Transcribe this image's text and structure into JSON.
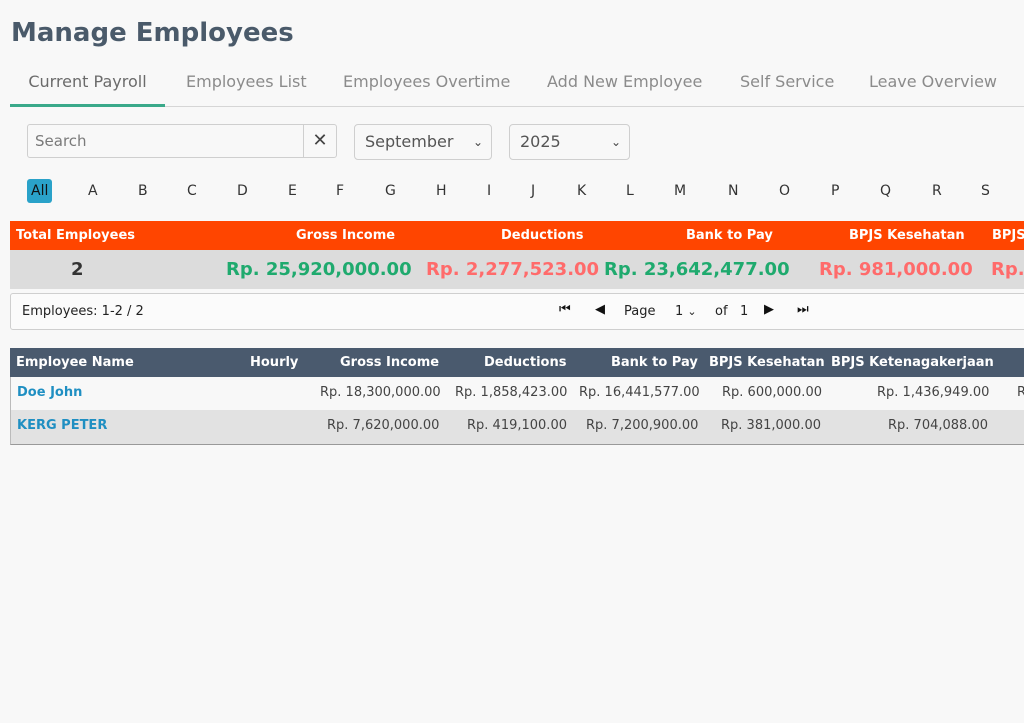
{
  "page": {
    "title": "Manage Employees"
  },
  "tabs": [
    {
      "label": "Current Payroll",
      "active": true
    },
    {
      "label": "Employees List"
    },
    {
      "label": "Employees Overtime"
    },
    {
      "label": "Add New Employee"
    },
    {
      "label": "Self Service"
    },
    {
      "label": "Leave Overview"
    }
  ],
  "filters": {
    "search_placeholder": "Search",
    "clear_icon": "✕",
    "month": "September",
    "year": "2025"
  },
  "alphabet": [
    "All",
    "A",
    "B",
    "C",
    "D",
    "E",
    "F",
    "G",
    "H",
    "I",
    "J",
    "K",
    "L",
    "M",
    "N",
    "O",
    "P",
    "Q",
    "R",
    "S"
  ],
  "summary": {
    "headers": {
      "total_employees": "Total Employees",
      "gross_income": "Gross Income",
      "deductions": "Deductions",
      "bank_to_pay": "Bank to Pay",
      "bpjs_kesehatan": "BPJS Kesehatan",
      "bpjs_next": "BPJS"
    },
    "values": {
      "total_employees": "2",
      "gross_income": "Rp. 25,920,000.00",
      "deductions": "Rp. 2,277,523.00",
      "bank_to_pay": "Rp. 23,642,477.00",
      "bpjs_kesehatan": "Rp. 981,000.00",
      "bpjs_next": "Rp."
    },
    "colors": {
      "header_bg": "#ff4500",
      "positive": "#1faa6e",
      "negative": "#ff6b6b"
    }
  },
  "pager": {
    "count_text": "Employees: 1-2 / 2",
    "page_label": "Page",
    "page_value": "1",
    "of_label": "of",
    "total_pages": "1"
  },
  "table": {
    "headers": {
      "name": "Employee Name",
      "hourly": "Hourly",
      "gross": "Gross Income",
      "deductions": "Deductions",
      "bank": "Bank to Pay",
      "bpjs_kes": "BPJS Kesehatan",
      "bpjs_ket": "BPJS Ketenagakerjaan"
    },
    "rows": [
      {
        "name": "Doe John",
        "hourly": "",
        "gross": "Rp. 18,300,000.00",
        "deductions": "Rp. 1,858,423.00",
        "bank": "Rp. 16,441,577.00",
        "bpjs_kes": "Rp. 600,000.00",
        "bpjs_ket": "Rp. 1,436,949.00",
        "extra": "R"
      },
      {
        "name": "KERG PETER",
        "hourly": "",
        "gross": "Rp. 7,620,000.00",
        "deductions": "Rp. 419,100.00",
        "bank": "Rp. 7,200,900.00",
        "bpjs_kes": "Rp. 381,000.00",
        "bpjs_ket": "Rp. 704,088.00",
        "extra": ""
      }
    ]
  }
}
